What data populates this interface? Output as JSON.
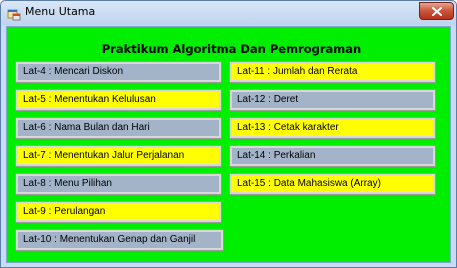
{
  "window": {
    "title": "Menu Utama"
  },
  "heading": "Praktikum Algoritma Dan Pemrograman",
  "colors": {
    "client_background": "#00ee00",
    "button_yellow": "#ffff00",
    "button_blue": "#a3b4c8"
  },
  "left_buttons": [
    {
      "label": "Lat-4 : Mencari  Diskon",
      "color": "blue"
    },
    {
      "label": "Lat-5 : Menentukan Kelulusan",
      "color": "yellow"
    },
    {
      "label": "Lat-6 : Nama Bulan dan Hari",
      "color": "blue"
    },
    {
      "label": "Lat-7 : Menentukan Jalur Perjalanan",
      "color": "yellow"
    },
    {
      "label": "Lat-8 : Menu Pilihan",
      "color": "blue"
    },
    {
      "label": "Lat-9 : Perulangan",
      "color": "yellow"
    },
    {
      "label": "Lat-10 : Menentukan Genap dan Ganjil",
      "color": "blue"
    }
  ],
  "right_buttons": [
    {
      "label": "Lat-11 : Jumlah dan Rerata",
      "color": "yellow"
    },
    {
      "label": "Lat-12 : Deret",
      "color": "blue"
    },
    {
      "label": "Lat-13 : Cetak karakter",
      "color": "yellow"
    },
    {
      "label": "Lat-14 : Perkalian",
      "color": "blue"
    },
    {
      "label": "Lat-15 : Data Mahasiswa (Array)",
      "color": "yellow"
    }
  ]
}
